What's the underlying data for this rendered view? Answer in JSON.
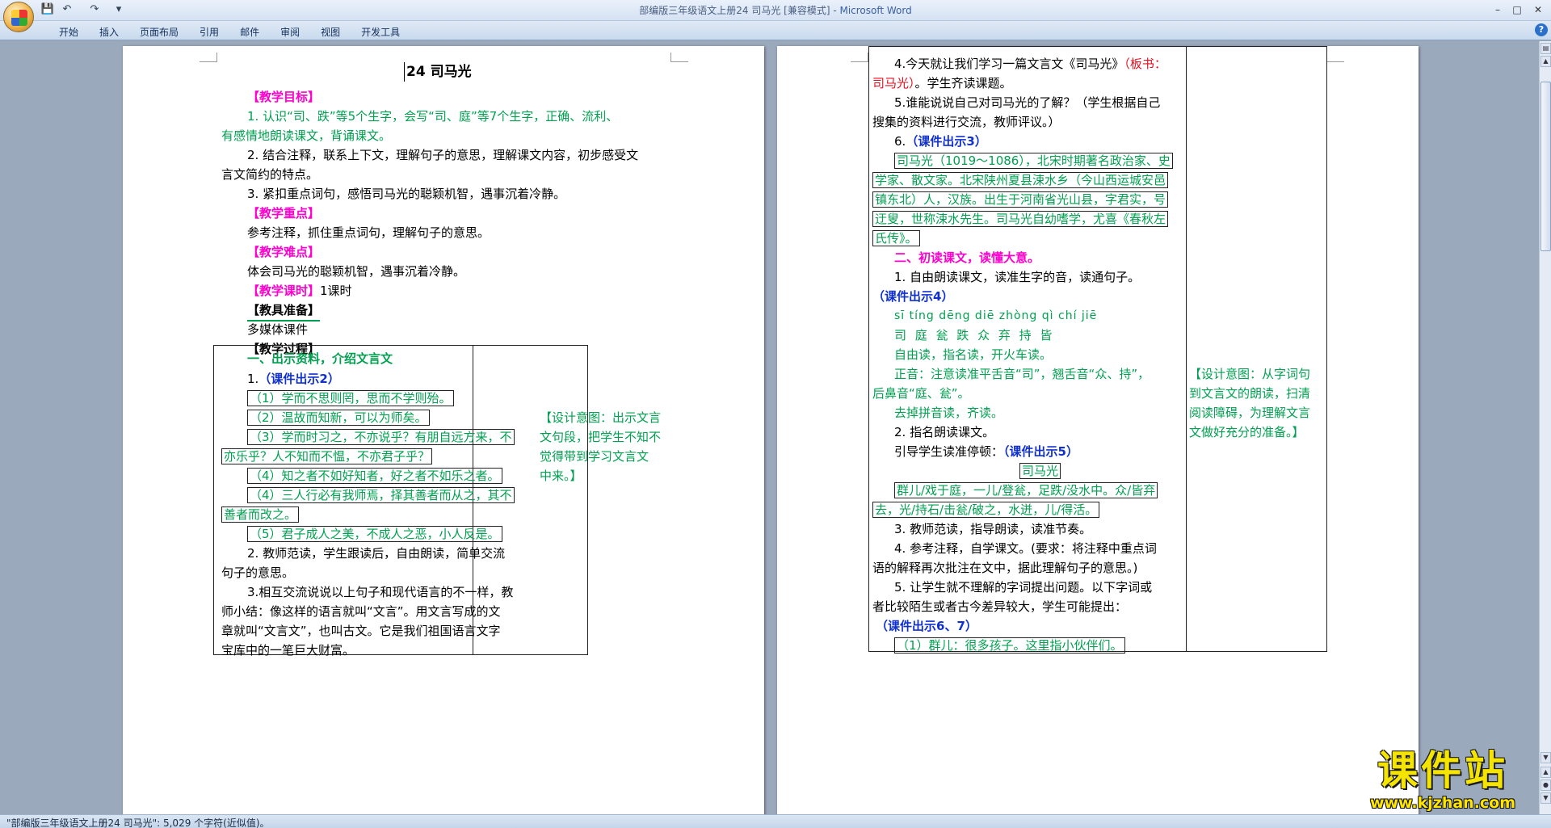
{
  "window": {
    "title_doc": "部编版三年级语文上册24  司马光  [兼容模式]",
    "title_sep": " - ",
    "title_app": "Microsoft Word"
  },
  "quick_access": {
    "save": "💾",
    "undo": "↶",
    "redo": "↷",
    "customize": "▾"
  },
  "window_controls": {
    "minimize": "–",
    "maximize": "□",
    "close": "✕"
  },
  "ribbon": {
    "tabs": [
      "开始",
      "插入",
      "页面布局",
      "引用",
      "邮件",
      "审阅",
      "视图",
      "开发工具"
    ],
    "help": "?"
  },
  "page1": {
    "title": "24  司马光",
    "l1": "【教学目标】",
    "l2": "1. 认识“司、跌”等5个生字，会写“司、庭”等7个生字，正确、流利、",
    "l3": "有感情地朗读课文，背诵课文。",
    "l4": "2. 结合注释，联系上下文，理解句子的意思，理解课文内容，初步感受文",
    "l5": "言文简约的特点。",
    "l6": "3. 紧扣重点词句，感悟司马光的聪颖机智，遇事沉着冷静。",
    "l7": "【教学重点】",
    "l8": "参考注释，抓住重点词句，理解句子的意思。",
    "l9": "【教学难点】",
    "l10": "体会司马光的聪颖机智，遇事沉着冷静。",
    "l11a": "【教学课时】",
    "l11b": "1课时",
    "l12": "【教具准备】",
    "l13": "多媒体课件",
    "l14": "【教学过程】",
    "t1": "一、出示资料，介绍文言文",
    "t2a": "1.",
    "t2b": "（课件出示2）",
    "t3": "（1）学而不思则罔，思而不学则殆。",
    "t4": "（2）温故而知新，可以为师矣。",
    "t5": "（3）学而时习之，不亦说乎？有朋自远方来，不",
    "t6": "亦乐乎？人不知而不愠，不亦君子乎？",
    "t7": "（4）知之者不如好知者，好之者不如乐之者。",
    "t8": "（4）三人行必有我师焉，择其善者而从之，其不",
    "t9": "善者而改之。",
    "t10": "（5）君子成人之美，不成人之恶，小人反是。",
    "t11": "2. 教师范读，学生跟读后，自由朗读，简单交流",
    "t12": "句子的意思。",
    "t13": "3.相互交流说说以上句子和现代语言的不一样，教",
    "t14": "师小结：像这样的语言就叫“文言”。用文言写成的文",
    "t15": "章就叫“文言文”，也叫古文。它是我们祖国语言文字",
    "t16": "宝库中的一笔巨大财富。",
    "d1": "【设计意图：出示文言",
    "d2": "文句段，把学生不知不",
    "d3": "觉得带到学习文言文",
    "d4": "中来。】"
  },
  "page2": {
    "r1a": "4.今天就让我们学习一篇文言文《司马光》",
    "r1b": "（板书：",
    "r2a": "司马光）",
    "r2b": "。学生齐读课题。",
    "r3": "5.谁能说说自己对司马光的了解？（学生根据自己",
    "r4": "搜集的资料进行交流，教师评议。）",
    "r5a": "6.",
    "r5b": "（课件出示3）",
    "r6": "司马光（1019～1086），北宋时期著名政治家、史",
    "r7": "学家、散文家。北宋陕州夏县涑水乡（今山西运城安邑",
    "r8": "镇东北）人，汉族。出生于河南省光山县，字君实，号",
    "r9": "迂叟，世称涑水先生。司马光自幼嗜学，尤喜《春秋左",
    "r10": "氏传》。",
    "r11": "二、初读课文，读懂大意。",
    "r12": "1. 自由朗读课文，读准生字的音，读通句子。",
    "r13": "（课件出示4）",
    "r14": "sī tíng dēng diē zhòng qì chí jiē",
    "r15": "司 庭   瓮   跌  众    弃 持  皆",
    "r16": "自由读，指名读，开火车读。",
    "r17": "正音：注意读准平舌音“司”，翘舌音“众、持”，",
    "r18": "后鼻音“庭、瓮”。",
    "r19": "去掉拼音读，齐读。",
    "r20": "2. 指名朗读课文。",
    "r21a": "引导学生读准停顿：",
    "r21b": "（课件出示5）",
    "r22": "司马光",
    "r23": "群儿/戏于庭，一儿/登瓮，足跌/没水中。众/皆弃",
    "r24": "去，光/持石/击瓮/破之，水迸，儿/得活。",
    "r25": "3. 教师范读，指导朗读，读准节奏。",
    "r26": "4. 参考注释，自学课文。(要求：将注释中重点词",
    "r27": "语的解释再次批注在文中，据此理解句子的意思。)",
    "r28": "5. 让学生就不理解的字词提出问题。以下字词或",
    "r29": "者比较陌生或者古今差异较大，学生可能提出：",
    "r30": "（课件出示6、7）",
    "r31": "（1）群儿：很多孩子。这里指小伙伴们。",
    "d1": "【设计意图：从字词句",
    "d2": "到文言文的朗读，扫清",
    "d3": "阅读障碍，为理解文言",
    "d4": "文做好充分的准备。】"
  },
  "status": {
    "text": "\"部编版三年级语文上册24  司马光\": 5,029 个字符(近似值)。"
  },
  "watermark": {
    "title": "课件站",
    "url": "www.kjzhan.com"
  },
  "colors": {
    "green": "#00a050",
    "magenta": "#ff00cc",
    "blue": "#1030d0",
    "red": "#e01020"
  }
}
